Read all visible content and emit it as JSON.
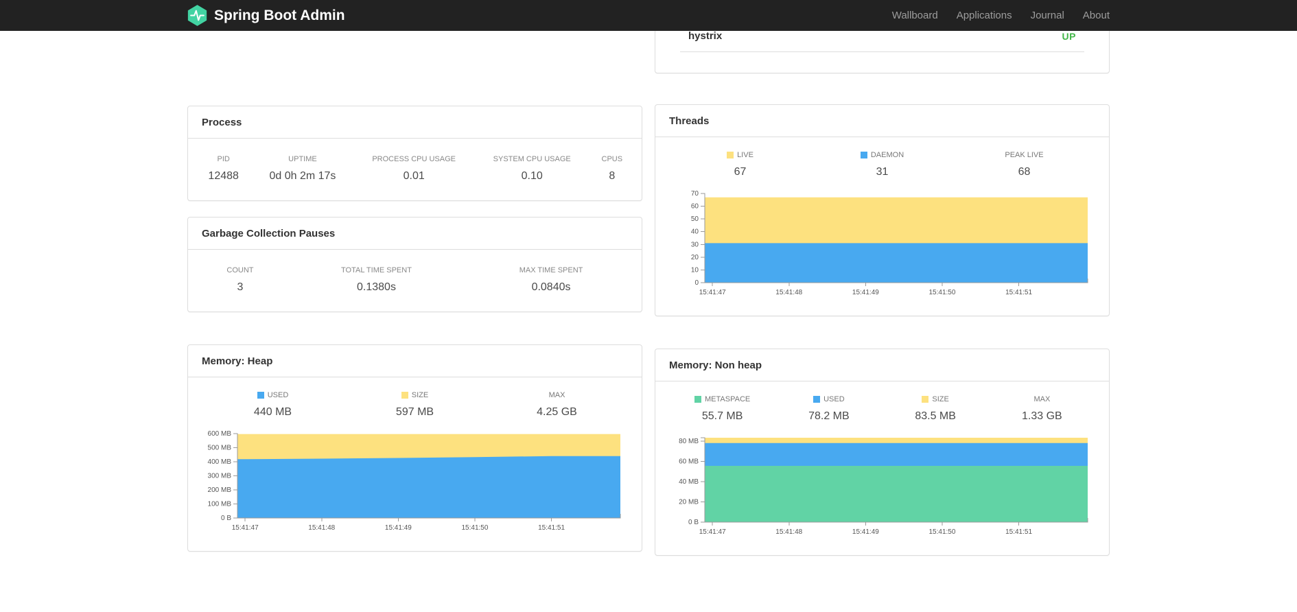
{
  "navbar": {
    "brand": "Spring Boot Admin",
    "brand_color": "#42d3a2",
    "items": [
      {
        "label": "Wallboard"
      },
      {
        "label": "Applications"
      },
      {
        "label": "Journal"
      },
      {
        "label": "About"
      }
    ]
  },
  "application": {
    "name": "hystrix",
    "status": "UP",
    "status_color": "#43b749"
  },
  "process": {
    "title": "Process",
    "metrics": [
      {
        "label": "PID",
        "value": "12488"
      },
      {
        "label": "UPTIME",
        "value": "0d 0h 2m 17s"
      },
      {
        "label": "PROCESS CPU USAGE",
        "value": "0.01"
      },
      {
        "label": "SYSTEM CPU USAGE",
        "value": "0.10"
      },
      {
        "label": "CPUS",
        "value": "8"
      }
    ]
  },
  "gc": {
    "title": "Garbage Collection Pauses",
    "metrics": [
      {
        "label": "COUNT",
        "value": "3"
      },
      {
        "label": "TOTAL TIME SPENT",
        "value": "0.1380s"
      },
      {
        "label": "MAX TIME SPENT",
        "value": "0.0840s"
      }
    ]
  },
  "threads": {
    "title": "Threads",
    "legend": [
      {
        "label": "LIVE",
        "value": "67",
        "color": "#fde17f"
      },
      {
        "label": "DAEMON",
        "value": "31",
        "color": "#48a9f0"
      },
      {
        "label": "PEAK LIVE",
        "value": "68"
      }
    ],
    "chart": {
      "type": "area",
      "h": 130,
      "ymax": 70,
      "x_labels": [
        "15:41:47",
        "15:41:48",
        "15:41:49",
        "15:41:50",
        "15:41:51"
      ],
      "y_ticks": [
        {
          "value": 0,
          "label": "0"
        },
        {
          "value": 10,
          "label": "10"
        },
        {
          "value": 20,
          "label": "20"
        },
        {
          "value": 30,
          "label": "30"
        },
        {
          "value": 40,
          "label": "40"
        },
        {
          "value": 50,
          "label": "50"
        },
        {
          "value": 60,
          "label": "60"
        },
        {
          "value": 70,
          "label": "70"
        }
      ],
      "series": [
        {
          "name": "LIVE",
          "color": "#fde17f",
          "values": [
            67,
            67,
            67,
            67,
            67
          ]
        },
        {
          "name": "DAEMON",
          "color": "#48a9f0",
          "values": [
            31,
            31,
            31,
            31,
            31
          ]
        }
      ]
    }
  },
  "memory_heap": {
    "title": "Memory: Heap",
    "legend": [
      {
        "label": "USED",
        "value": "440 MB",
        "color": "#48a9f0"
      },
      {
        "label": "SIZE",
        "value": "597 MB",
        "color": "#fde17f"
      },
      {
        "label": "MAX",
        "value": "4.25 GB"
      }
    ],
    "chart": {
      "type": "area",
      "h": 123,
      "ymax": 600,
      "x_labels": [
        "15:41:47",
        "15:41:48",
        "15:41:49",
        "15:41:50",
        "15:41:51"
      ],
      "y_ticks": [
        {
          "value": 0,
          "label": "0 B"
        },
        {
          "value": 100,
          "label": "100 MB"
        },
        {
          "value": 200,
          "label": "200 MB"
        },
        {
          "value": 300,
          "label": "300 MB"
        },
        {
          "value": 400,
          "label": "400 MB"
        },
        {
          "value": 500,
          "label": "500 MB"
        },
        {
          "value": 600,
          "label": "600 MB"
        }
      ],
      "series": [
        {
          "name": "SIZE",
          "color": "#fde17f",
          "values": [
            597,
            597,
            597,
            597,
            597
          ]
        },
        {
          "name": "USED",
          "color": "#48a9f0",
          "values": [
            418,
            422,
            427,
            433,
            440
          ]
        }
      ]
    }
  },
  "memory_nonheap": {
    "title": "Memory: Non heap",
    "legend": [
      {
        "label": "METASPACE",
        "value": "55.7 MB",
        "color": "#61d3a5"
      },
      {
        "label": "USED",
        "value": "78.2 MB",
        "color": "#48a9f0"
      },
      {
        "label": "SIZE",
        "value": "83.5 MB",
        "color": "#fde17f"
      },
      {
        "label": "MAX",
        "value": "1.33 GB"
      }
    ],
    "chart": {
      "type": "area",
      "h": 123,
      "ymax": 83.5,
      "x_labels": [
        "15:41:47",
        "15:41:48",
        "15:41:49",
        "15:41:50",
        "15:41:51"
      ],
      "y_ticks": [
        {
          "value": 0,
          "label": "0 B"
        },
        {
          "value": 20,
          "label": "20 MB"
        },
        {
          "value": 40,
          "label": "40 MB"
        },
        {
          "value": 60,
          "label": "60 MB"
        },
        {
          "value": 80,
          "label": "80 MB"
        }
      ],
      "series": [
        {
          "name": "SIZE",
          "color": "#fde17f",
          "values": [
            83.5,
            83.5,
            83.5,
            83.5,
            83.5
          ]
        },
        {
          "name": "USED",
          "color": "#48a9f0",
          "values": [
            78.2,
            78.2,
            78.2,
            78.2,
            78.2
          ]
        },
        {
          "name": "METASPACE",
          "color": "#61d3a5",
          "values": [
            55.7,
            55.7,
            55.7,
            55.7,
            55.7
          ]
        }
      ]
    }
  }
}
